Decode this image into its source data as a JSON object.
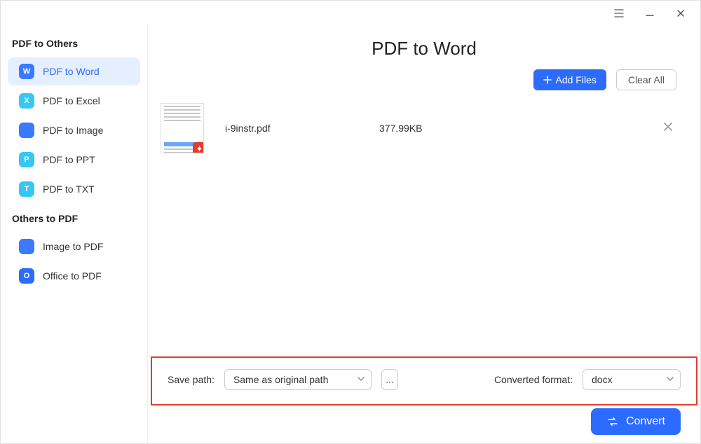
{
  "sidebar": {
    "group1_title": "PDF to Others",
    "group2_title": "Others to PDF",
    "items1": [
      {
        "label": "PDF to Word",
        "glyph": "W",
        "cls": "si-word",
        "active": true
      },
      {
        "label": "PDF to Excel",
        "glyph": "X",
        "cls": "si-excel",
        "active": false
      },
      {
        "label": "PDF to Image",
        "glyph": " ",
        "cls": "si-image",
        "active": false
      },
      {
        "label": "PDF to PPT",
        "glyph": "P",
        "cls": "si-ppt",
        "active": false
      },
      {
        "label": "PDF to TXT",
        "glyph": "T",
        "cls": "si-txt",
        "active": false
      }
    ],
    "items2": [
      {
        "label": "Image to PDF",
        "glyph": " ",
        "cls": "si-img2"
      },
      {
        "label": "Office to PDF",
        "glyph": "O",
        "cls": "si-office"
      }
    ]
  },
  "header": {
    "page_title": "PDF to Word",
    "add_files_label": "Add Files",
    "clear_all_label": "Clear All"
  },
  "file": {
    "name": "i-9instr.pdf",
    "size": "377.99KB"
  },
  "bottom": {
    "save_path_label": "Save path:",
    "save_path_value": "Same as original path",
    "browse_label": "...",
    "converted_format_label": "Converted format:",
    "converted_format_value": "docx"
  },
  "convert": {
    "label": "Convert"
  }
}
